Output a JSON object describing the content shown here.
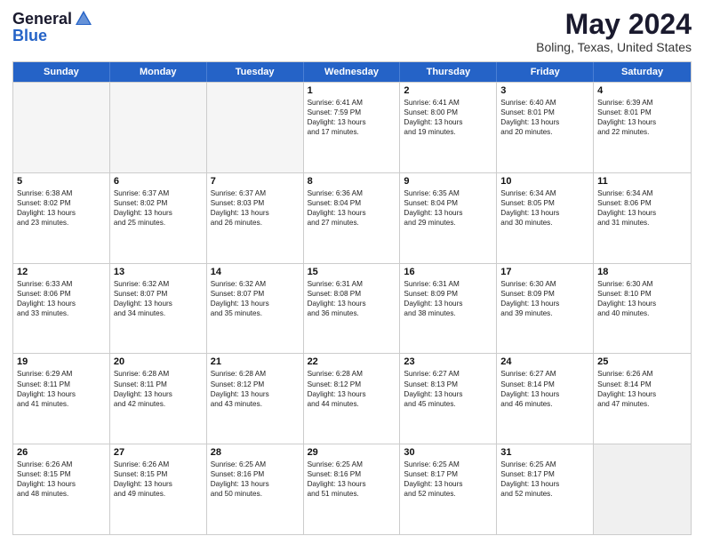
{
  "logo": {
    "general": "General",
    "blue": "Blue"
  },
  "title": "May 2024",
  "subtitle": "Boling, Texas, United States",
  "headers": [
    "Sunday",
    "Monday",
    "Tuesday",
    "Wednesday",
    "Thursday",
    "Friday",
    "Saturday"
  ],
  "weeks": [
    [
      {
        "day": "",
        "lines": [],
        "empty": true
      },
      {
        "day": "",
        "lines": [],
        "empty": true
      },
      {
        "day": "",
        "lines": [],
        "empty": true
      },
      {
        "day": "1",
        "lines": [
          "Sunrise: 6:41 AM",
          "Sunset: 7:59 PM",
          "Daylight: 13 hours",
          "and 17 minutes."
        ]
      },
      {
        "day": "2",
        "lines": [
          "Sunrise: 6:41 AM",
          "Sunset: 8:00 PM",
          "Daylight: 13 hours",
          "and 19 minutes."
        ]
      },
      {
        "day": "3",
        "lines": [
          "Sunrise: 6:40 AM",
          "Sunset: 8:01 PM",
          "Daylight: 13 hours",
          "and 20 minutes."
        ]
      },
      {
        "day": "4",
        "lines": [
          "Sunrise: 6:39 AM",
          "Sunset: 8:01 PM",
          "Daylight: 13 hours",
          "and 22 minutes."
        ]
      }
    ],
    [
      {
        "day": "5",
        "lines": [
          "Sunrise: 6:38 AM",
          "Sunset: 8:02 PM",
          "Daylight: 13 hours",
          "and 23 minutes."
        ]
      },
      {
        "day": "6",
        "lines": [
          "Sunrise: 6:37 AM",
          "Sunset: 8:02 PM",
          "Daylight: 13 hours",
          "and 25 minutes."
        ]
      },
      {
        "day": "7",
        "lines": [
          "Sunrise: 6:37 AM",
          "Sunset: 8:03 PM",
          "Daylight: 13 hours",
          "and 26 minutes."
        ]
      },
      {
        "day": "8",
        "lines": [
          "Sunrise: 6:36 AM",
          "Sunset: 8:04 PM",
          "Daylight: 13 hours",
          "and 27 minutes."
        ]
      },
      {
        "day": "9",
        "lines": [
          "Sunrise: 6:35 AM",
          "Sunset: 8:04 PM",
          "Daylight: 13 hours",
          "and 29 minutes."
        ]
      },
      {
        "day": "10",
        "lines": [
          "Sunrise: 6:34 AM",
          "Sunset: 8:05 PM",
          "Daylight: 13 hours",
          "and 30 minutes."
        ]
      },
      {
        "day": "11",
        "lines": [
          "Sunrise: 6:34 AM",
          "Sunset: 8:06 PM",
          "Daylight: 13 hours",
          "and 31 minutes."
        ]
      }
    ],
    [
      {
        "day": "12",
        "lines": [
          "Sunrise: 6:33 AM",
          "Sunset: 8:06 PM",
          "Daylight: 13 hours",
          "and 33 minutes."
        ]
      },
      {
        "day": "13",
        "lines": [
          "Sunrise: 6:32 AM",
          "Sunset: 8:07 PM",
          "Daylight: 13 hours",
          "and 34 minutes."
        ]
      },
      {
        "day": "14",
        "lines": [
          "Sunrise: 6:32 AM",
          "Sunset: 8:07 PM",
          "Daylight: 13 hours",
          "and 35 minutes."
        ]
      },
      {
        "day": "15",
        "lines": [
          "Sunrise: 6:31 AM",
          "Sunset: 8:08 PM",
          "Daylight: 13 hours",
          "and 36 minutes."
        ]
      },
      {
        "day": "16",
        "lines": [
          "Sunrise: 6:31 AM",
          "Sunset: 8:09 PM",
          "Daylight: 13 hours",
          "and 38 minutes."
        ]
      },
      {
        "day": "17",
        "lines": [
          "Sunrise: 6:30 AM",
          "Sunset: 8:09 PM",
          "Daylight: 13 hours",
          "and 39 minutes."
        ]
      },
      {
        "day": "18",
        "lines": [
          "Sunrise: 6:30 AM",
          "Sunset: 8:10 PM",
          "Daylight: 13 hours",
          "and 40 minutes."
        ]
      }
    ],
    [
      {
        "day": "19",
        "lines": [
          "Sunrise: 6:29 AM",
          "Sunset: 8:11 PM",
          "Daylight: 13 hours",
          "and 41 minutes."
        ]
      },
      {
        "day": "20",
        "lines": [
          "Sunrise: 6:28 AM",
          "Sunset: 8:11 PM",
          "Daylight: 13 hours",
          "and 42 minutes."
        ]
      },
      {
        "day": "21",
        "lines": [
          "Sunrise: 6:28 AM",
          "Sunset: 8:12 PM",
          "Daylight: 13 hours",
          "and 43 minutes."
        ]
      },
      {
        "day": "22",
        "lines": [
          "Sunrise: 6:28 AM",
          "Sunset: 8:12 PM",
          "Daylight: 13 hours",
          "and 44 minutes."
        ]
      },
      {
        "day": "23",
        "lines": [
          "Sunrise: 6:27 AM",
          "Sunset: 8:13 PM",
          "Daylight: 13 hours",
          "and 45 minutes."
        ]
      },
      {
        "day": "24",
        "lines": [
          "Sunrise: 6:27 AM",
          "Sunset: 8:14 PM",
          "Daylight: 13 hours",
          "and 46 minutes."
        ]
      },
      {
        "day": "25",
        "lines": [
          "Sunrise: 6:26 AM",
          "Sunset: 8:14 PM",
          "Daylight: 13 hours",
          "and 47 minutes."
        ]
      }
    ],
    [
      {
        "day": "26",
        "lines": [
          "Sunrise: 6:26 AM",
          "Sunset: 8:15 PM",
          "Daylight: 13 hours",
          "and 48 minutes."
        ]
      },
      {
        "day": "27",
        "lines": [
          "Sunrise: 6:26 AM",
          "Sunset: 8:15 PM",
          "Daylight: 13 hours",
          "and 49 minutes."
        ]
      },
      {
        "day": "28",
        "lines": [
          "Sunrise: 6:25 AM",
          "Sunset: 8:16 PM",
          "Daylight: 13 hours",
          "and 50 minutes."
        ]
      },
      {
        "day": "29",
        "lines": [
          "Sunrise: 6:25 AM",
          "Sunset: 8:16 PM",
          "Daylight: 13 hours",
          "and 51 minutes."
        ]
      },
      {
        "day": "30",
        "lines": [
          "Sunrise: 6:25 AM",
          "Sunset: 8:17 PM",
          "Daylight: 13 hours",
          "and 52 minutes."
        ]
      },
      {
        "day": "31",
        "lines": [
          "Sunrise: 6:25 AM",
          "Sunset: 8:17 PM",
          "Daylight: 13 hours",
          "and 52 minutes."
        ]
      },
      {
        "day": "",
        "lines": [],
        "empty": true,
        "shaded": true
      }
    ]
  ]
}
